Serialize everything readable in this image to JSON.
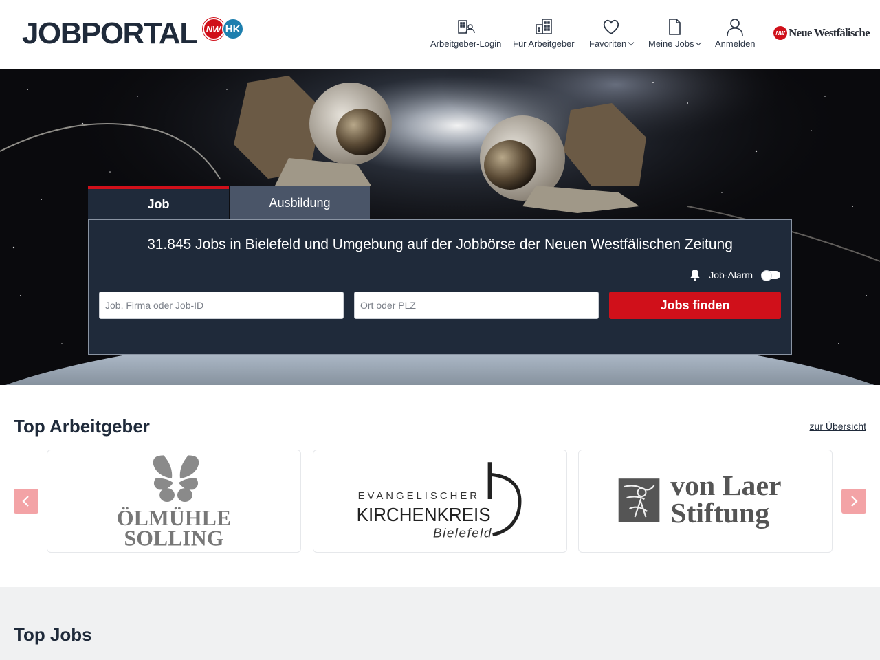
{
  "header": {
    "logo_text": "JOBPORTAL",
    "badge_nw": "NW",
    "badge_hk": "HK",
    "nav": [
      {
        "label": "Arbeitgeber-Login",
        "icon": "employer-login-icon"
      },
      {
        "label": "Für Arbeitgeber",
        "icon": "building-icon"
      },
      {
        "label": "Favoriten",
        "icon": "heart-icon"
      },
      {
        "label": "Meine Jobs",
        "icon": "document-icon"
      },
      {
        "label": "Anmelden",
        "icon": "user-icon"
      }
    ],
    "brand_mini": "NW",
    "brand_text": "Neue Westfälische"
  },
  "search": {
    "tabs": [
      {
        "label": "Job",
        "active": true
      },
      {
        "label": "Ausbildung",
        "active": false
      }
    ],
    "title": "31.845 Jobs in Bielefeld und Umgebung auf der Jobbörse der Neuen Westfälischen Zeitung",
    "alarm_label": "Job-Alarm",
    "job_placeholder": "Job, Firma oder Job-ID",
    "ort_placeholder": "Ort oder PLZ",
    "button_label": "Jobs finden"
  },
  "top_employers": {
    "title": "Top Arbeitgeber",
    "overview_link": "zur Übersicht",
    "employers": [
      {
        "name_line1": "ÖLMÜHLE",
        "name_line2": "SOLLING"
      },
      {
        "name_line1": "EVANGELISCHER",
        "name_line2": "KIRCHENKREIS",
        "name_line3": "Bielefeld"
      },
      {
        "name_line1": "von Laer",
        "name_line2": "Stiftung"
      }
    ]
  },
  "top_jobs": {
    "title": "Top Jobs"
  },
  "colors": {
    "brand_red": "#d0101a",
    "navy": "#1f2a3a",
    "hk_blue": "#1d7fae"
  }
}
